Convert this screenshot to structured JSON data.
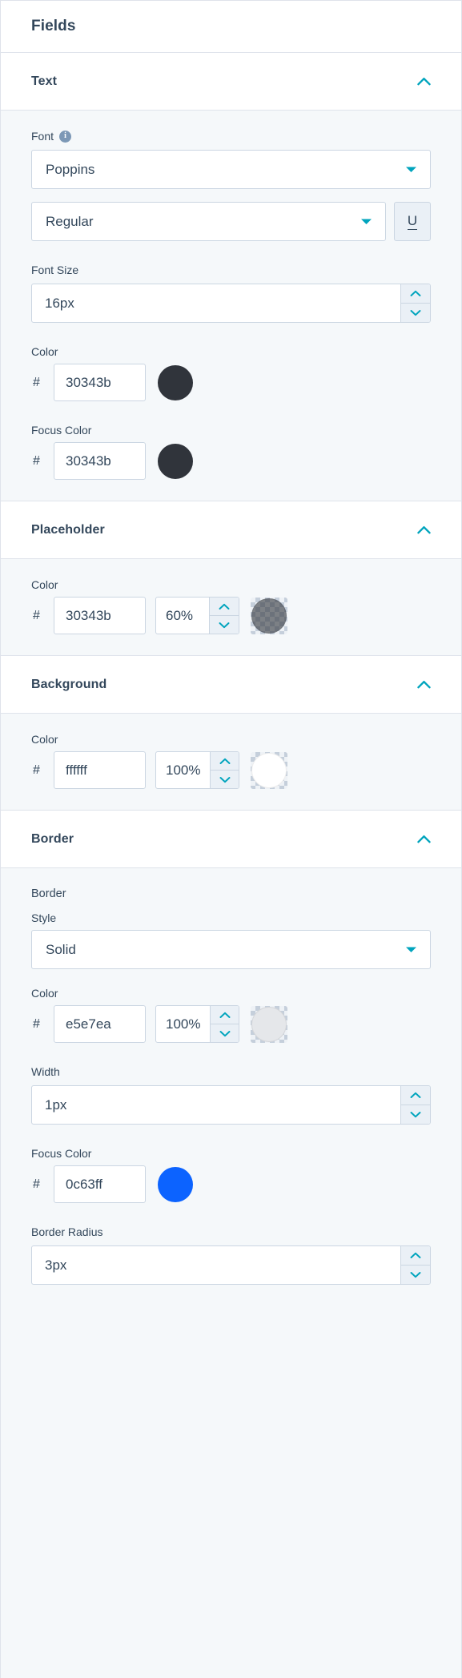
{
  "panel": {
    "title": "Fields"
  },
  "icons": {
    "collapse": "chevron-up-icon",
    "dropdown": "caret-down-icon",
    "stepper_up": "chevron-up-icon",
    "stepper_down": "chevron-down-icon",
    "info": "info-icon",
    "underline": "underline-icon"
  },
  "colors": {
    "accent_teal": "#00a4bd",
    "text": "#33475b",
    "border": "#cbd6e2",
    "body_bg": "#f5f8fa",
    "header_bg": "#ffffff",
    "stepper_bg": "#eaf0f6"
  },
  "sections": {
    "text": {
      "header": "Text",
      "font": {
        "label": "Font",
        "has_info": true,
        "family_value": "Poppins",
        "weight_value": "Regular",
        "underline_label": "U"
      },
      "font_size": {
        "label": "Font Size",
        "value": "16px"
      },
      "color": {
        "label": "Color",
        "hash": "#",
        "hex": "30343b",
        "swatch": "#30343b"
      },
      "focus_color": {
        "label": "Focus Color",
        "hash": "#",
        "hex": "30343b",
        "swatch": "#30343b"
      }
    },
    "placeholder": {
      "header": "Placeholder",
      "color": {
        "label": "Color",
        "hash": "#",
        "hex": "30343b",
        "opacity": "60%",
        "swatch": "#30343b",
        "swatch_alpha": 0.6
      }
    },
    "background": {
      "header": "Background",
      "color": {
        "label": "Color",
        "hash": "#",
        "hex": "ffffff",
        "opacity": "100%",
        "swatch": "#ffffff",
        "swatch_alpha": 1
      }
    },
    "border": {
      "header": "Border",
      "sub_label": "Border",
      "style": {
        "label": "Style",
        "value": "Solid"
      },
      "color": {
        "label": "Color",
        "hash": "#",
        "hex": "e5e7ea",
        "opacity": "100%",
        "swatch": "#e5e7ea",
        "swatch_alpha": 1
      },
      "width": {
        "label": "Width",
        "value": "1px"
      },
      "focus_color": {
        "label": "Focus Color",
        "hash": "#",
        "hex": "0c63ff",
        "swatch": "#0c63ff"
      },
      "border_radius": {
        "label": "Border Radius",
        "value": "3px"
      }
    }
  }
}
